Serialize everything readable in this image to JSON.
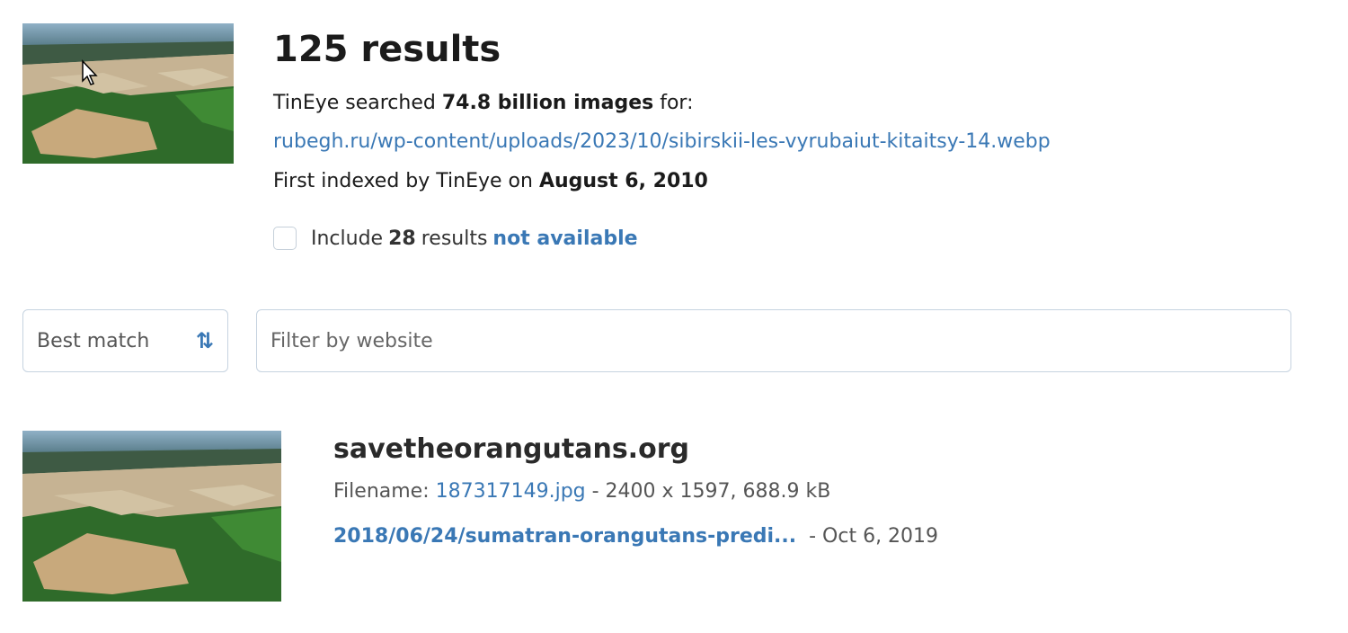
{
  "query": {
    "results_count": "125 results",
    "searched_prefix": "TinEye searched ",
    "searched_amount": "74.8 billion images",
    "searched_suffix": " for:",
    "source_url": "rubegh.ru/wp-content/uploads/2023/10/sibirskii-les-vyrubaiut-kitaitsy-14.webp",
    "first_indexed_prefix": "First indexed by TinEye on ",
    "first_indexed_date": "August 6, 2010",
    "include_prefix": "Include",
    "include_count": "28",
    "include_middle": "results",
    "include_link": "not available"
  },
  "controls": {
    "sort_label": "Best match",
    "filter_placeholder": "Filter by website"
  },
  "result": {
    "domain": "savetheorangutans.org",
    "filename_prefix": "Filename: ",
    "filename": "187317149.jpg",
    "details": " - 2400 x 1597, 688.9 kB",
    "path": "2018/06/24/sumatran-orangutans-predi...",
    "date": " - Oct 6, 2019"
  },
  "colors": {
    "link": "#3a78b5",
    "border": "#c6d3e0"
  }
}
